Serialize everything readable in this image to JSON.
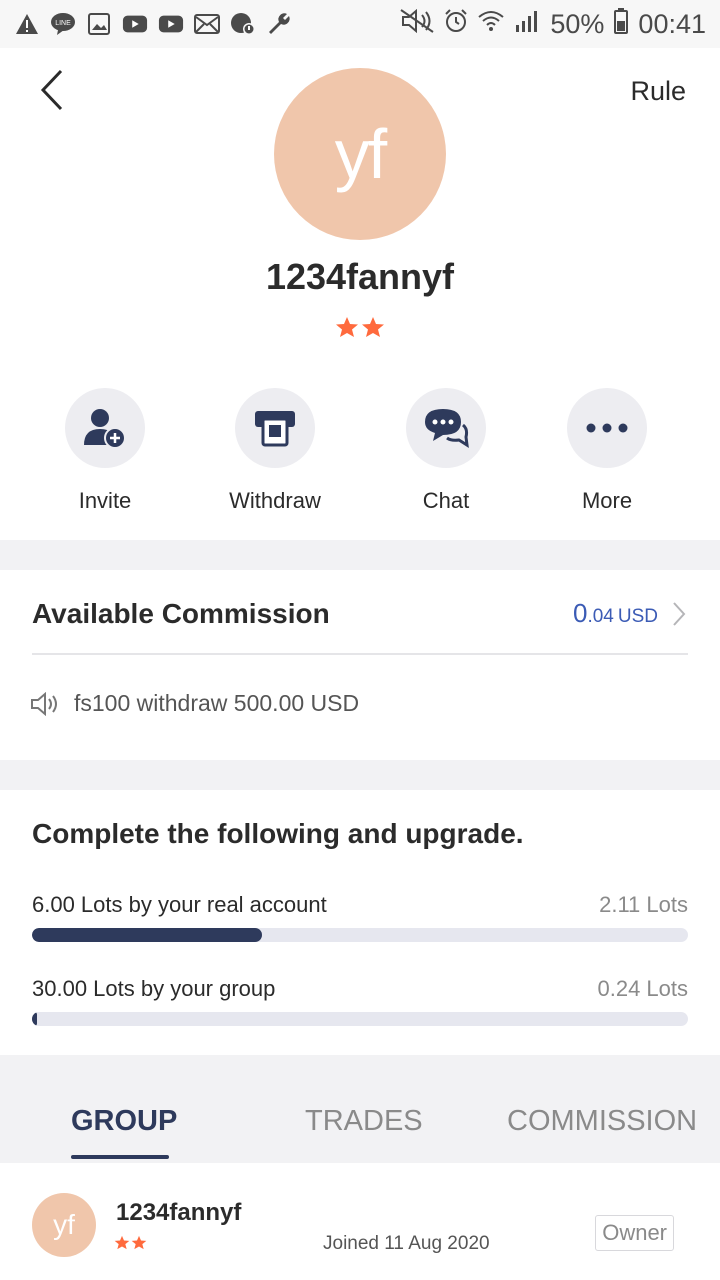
{
  "status_bar": {
    "battery": "50%",
    "time": "00:41",
    "icons_left": [
      "warning-icon",
      "line-app-icon",
      "image-icon",
      "youtube-icon",
      "youtube-icon",
      "mail-icon",
      "blocked-icon",
      "wrench-icon"
    ],
    "icons_right": [
      "mute-icon",
      "alarm-icon",
      "wifi-icon",
      "signal-icon",
      "battery-icon"
    ]
  },
  "header": {
    "rule_label": "Rule",
    "avatar_initials": "yf",
    "username": "1234fannyf",
    "star_count": 2
  },
  "actions": [
    {
      "label": "Invite",
      "icon": "add-user-icon"
    },
    {
      "label": "Withdraw",
      "icon": "atm-icon"
    },
    {
      "label": "Chat",
      "icon": "chat-icon"
    },
    {
      "label": "More",
      "icon": "more-icon"
    }
  ],
  "commission": {
    "title": "Available Commission",
    "value_int": "0",
    "value_dec": ".04",
    "unit": "USD",
    "notice": "fs100 withdraw 500.00 USD"
  },
  "upgrade": {
    "title": "Complete the following and upgrade.",
    "tasks": [
      {
        "label": "6.00 Lots by your real account",
        "value": "2.11 Lots",
        "progress": 0.35
      },
      {
        "label": "30.00 Lots by your group",
        "value": "0.24 Lots",
        "progress": 0.008
      }
    ]
  },
  "tabs": [
    {
      "label": "GROUP",
      "active": true
    },
    {
      "label": "TRADES",
      "active": false
    },
    {
      "label": "COMMISSION",
      "active": false
    }
  ],
  "member": {
    "avatar_initials": "yf",
    "name": "1234fannyf",
    "joined": "Joined 11 Aug 2020",
    "badge": "Owner",
    "star_count": 2
  },
  "colors": {
    "accent": "#2e3a5c",
    "link": "#3b5bb5",
    "star": "#ff6a3d",
    "avatar": "#f0c6ab"
  }
}
